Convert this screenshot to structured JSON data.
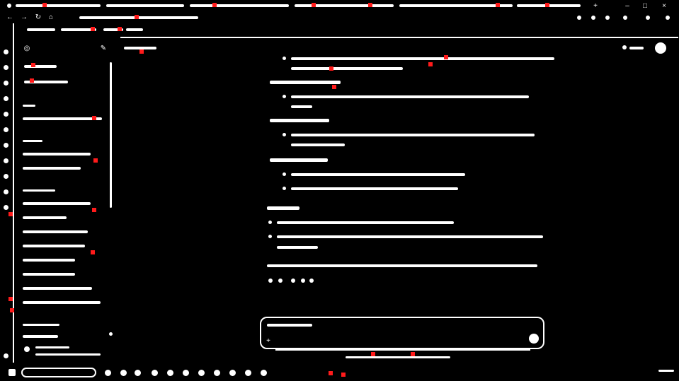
{
  "browser": {
    "tabs": [],
    "address": "",
    "bookmarks": []
  },
  "sidebar": {
    "new_chat_label": "",
    "search_label": "",
    "sections": []
  },
  "main": {
    "header_title": "",
    "content_lines": []
  },
  "composer": {
    "placeholder": "",
    "disclaimer": ""
  },
  "taskbar": {
    "search_label": "",
    "clock": ""
  },
  "colors": {
    "background": "#000000",
    "foreground": "#ffffff",
    "highlight": "#ff1b1b"
  }
}
